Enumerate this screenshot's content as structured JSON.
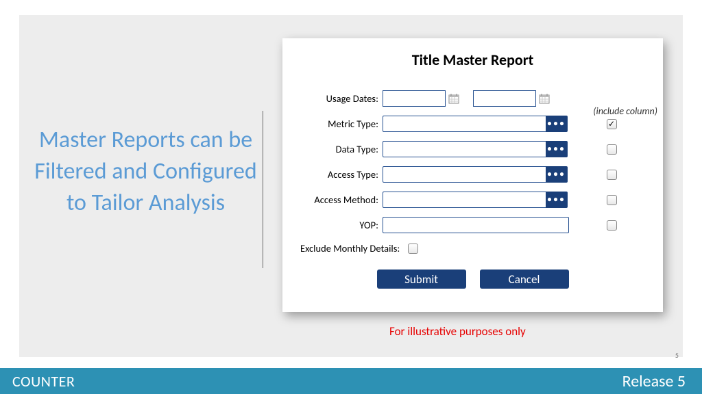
{
  "left_text": "Master Reports can be Filtered and Configured to Tailor Analysis",
  "panel": {
    "title": "Title Master Report",
    "labels": {
      "usage_dates": "Usage Dates:",
      "metric_type": "Metric Type:",
      "data_type": "Data Type:",
      "access_type": "Access Type:",
      "access_method": "Access Method:",
      "yop": "YOP:",
      "exclude_monthly": "Exclude Monthly Details:"
    },
    "include_column": "(include column)",
    "ellipsis": "•••",
    "checkmark": "✓",
    "submit": "Submit",
    "cancel": "Cancel"
  },
  "illustrative": "For illustrative purposes only",
  "page_number": "5",
  "footer": {
    "brand_a": "CO",
    "brand_b": "UNTER",
    "release": "Release 5"
  }
}
